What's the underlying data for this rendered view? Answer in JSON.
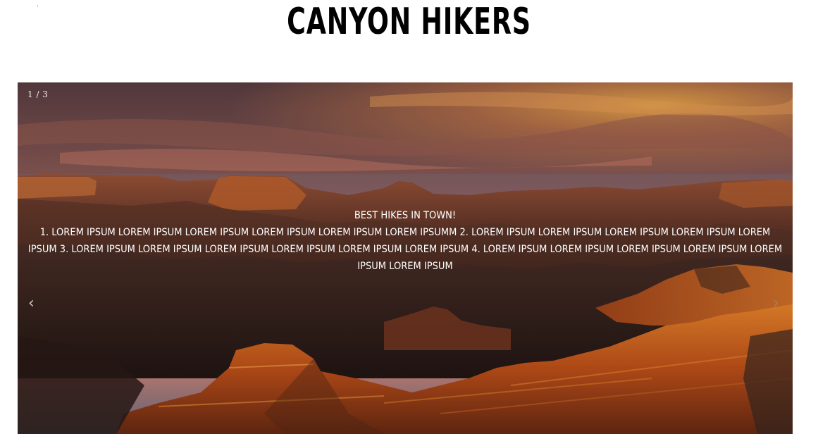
{
  "site": {
    "title": "CANYON HIKERS"
  },
  "slideshow": {
    "counter": "1 / 3",
    "caption_heading": "BEST HIKES IN TOWN!",
    "caption_body": "1. LOREM IPSUM LOREM IPSUM LOREM IPSUM LOREM IPSUM LOREM IPSUM LOREM IPSUMM 2. LOREM IPSUM LOREM IPSUM LOREM IPSUM LOREM IPSUM LOREM IPSUM 3. LOREM IPSUM LOREM IPSUM LOREM IPSUM LOREM IPSUM LOREM IPSUM LOREM IPSUM 4. LOREM IPSUM LOREM IPSUM LOREM IPSUM LOREM IPSUM LOREM IPSUM LOREM IPSUM",
    "prev_icon": "‹",
    "next_icon": "›",
    "icons": {
      "prev": "chevron-left-icon",
      "next": "chevron-right-icon"
    }
  },
  "colors": {
    "title_text": "#000000",
    "caption_text": "#ffffff",
    "sky_top": "#6e4a4c",
    "sky_glow": "#f2a24a",
    "canyon_lit": "#d9641c"
  }
}
